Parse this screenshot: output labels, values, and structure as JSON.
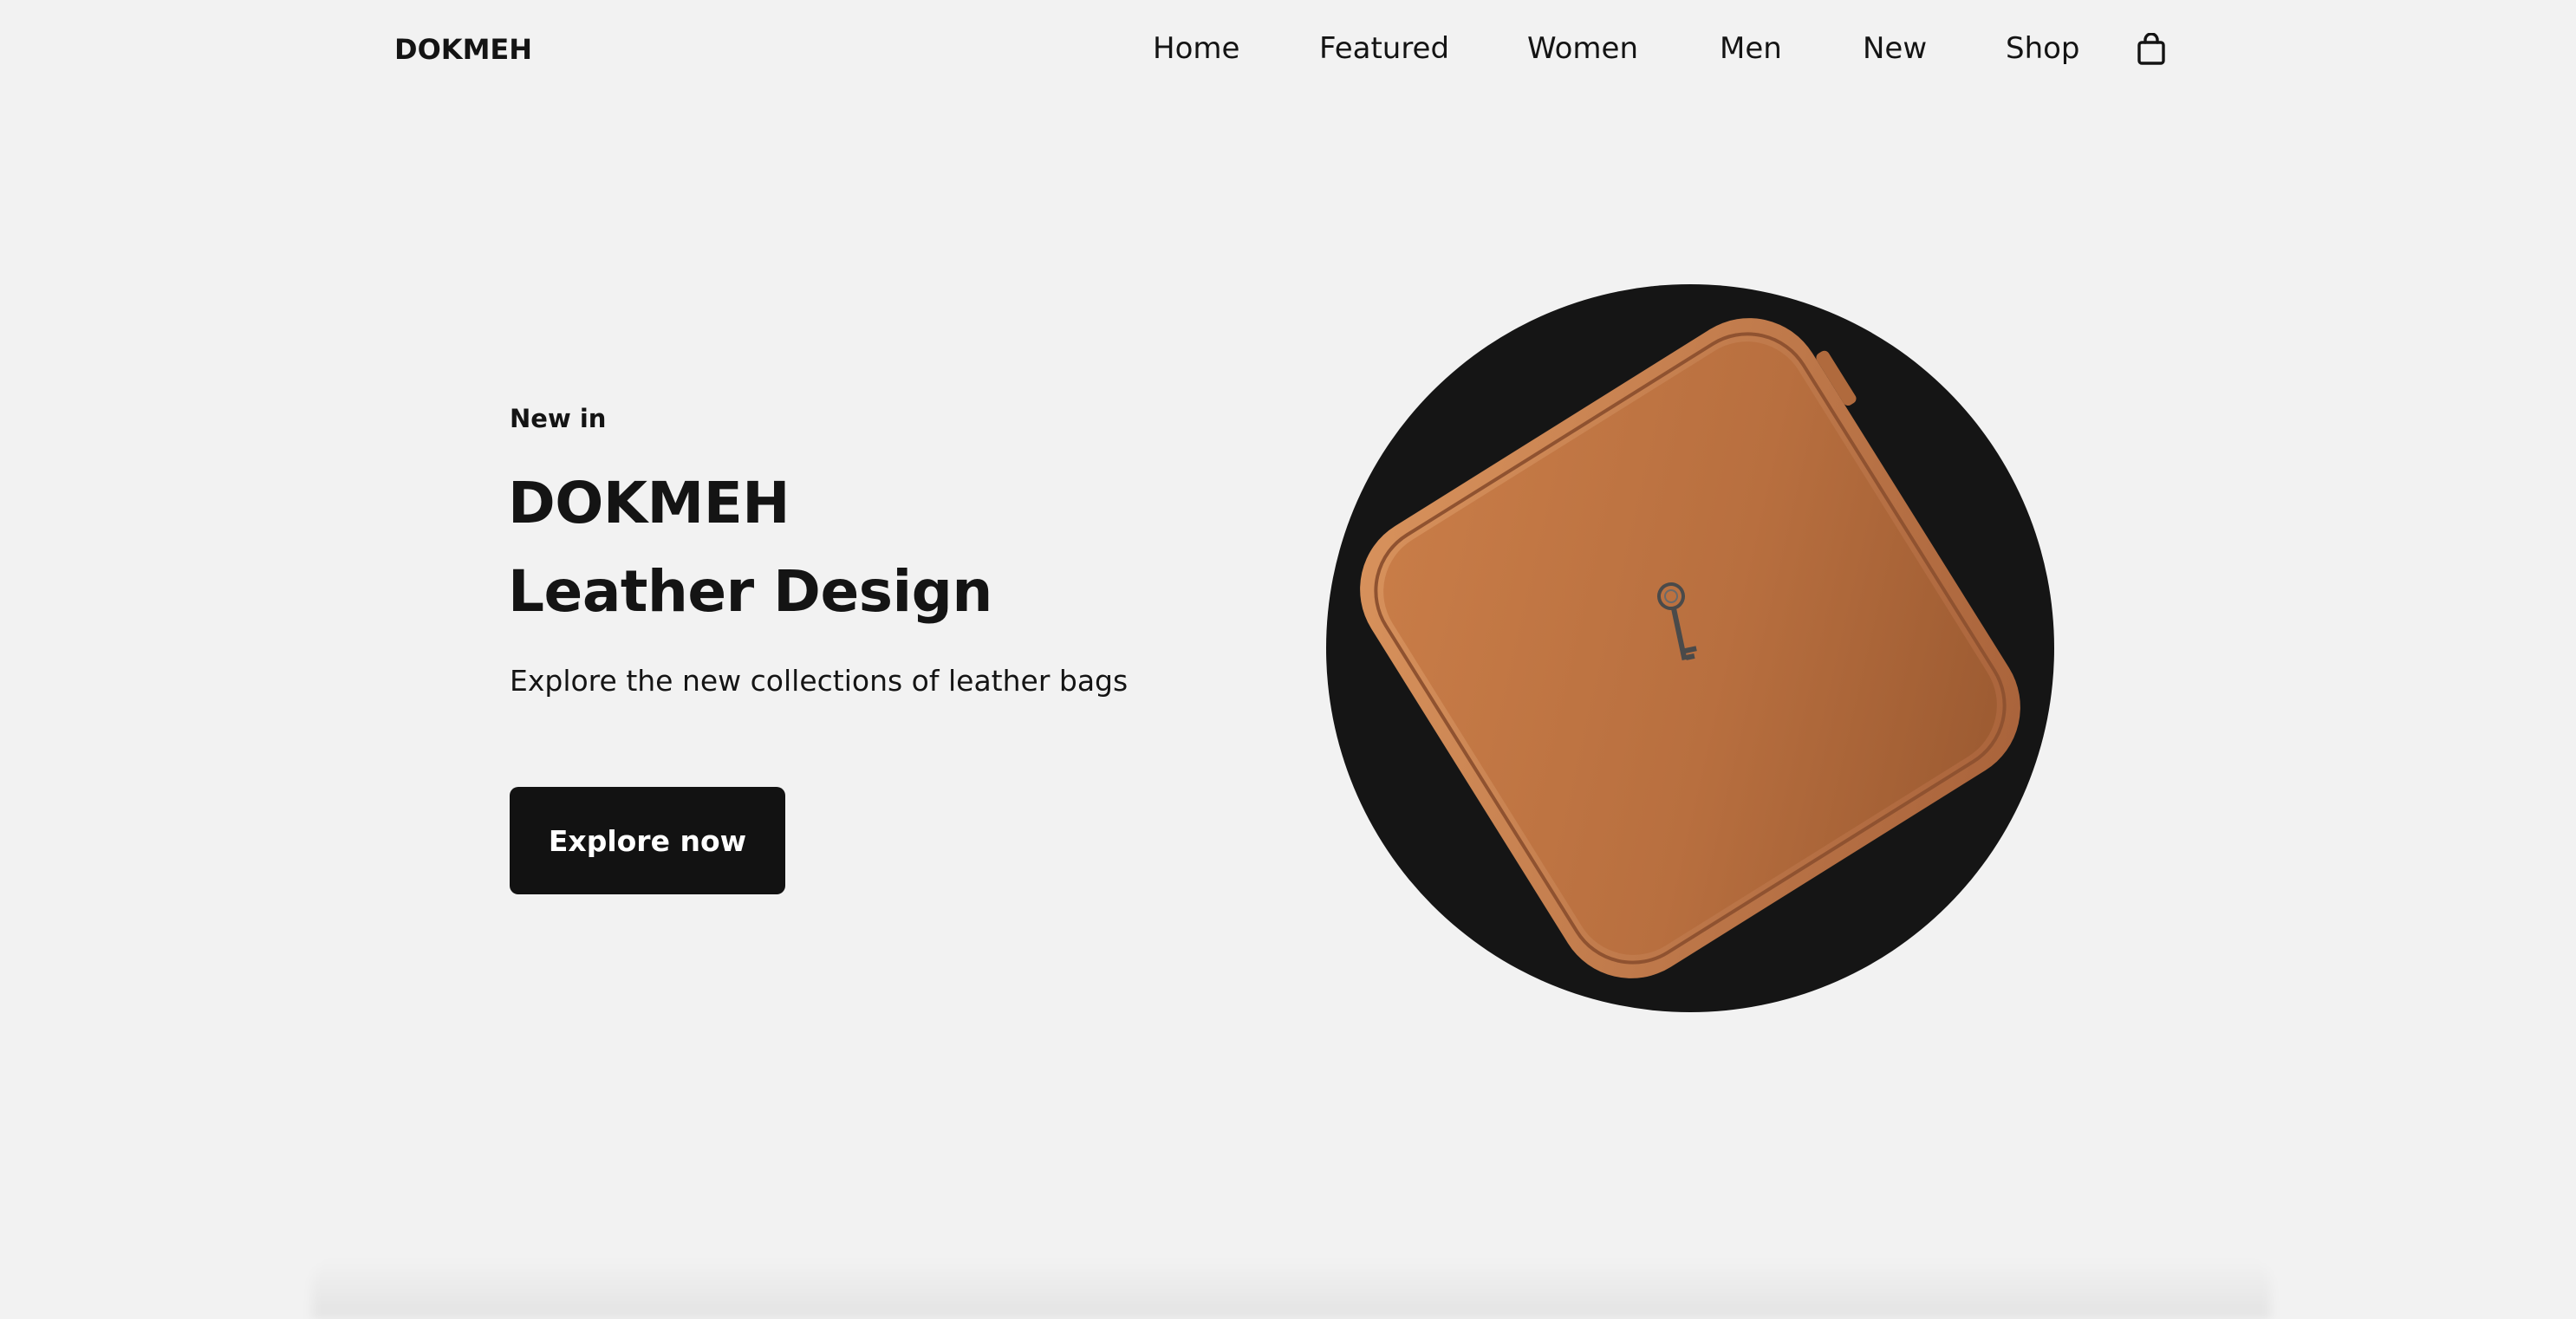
{
  "brand": {
    "name": "DOKMEH"
  },
  "nav": {
    "items": [
      "Home",
      "Featured",
      "Women",
      "Men",
      "New",
      "Shop"
    ],
    "cart_icon": "shopping-bag-icon"
  },
  "hero": {
    "kicker": "New in",
    "headline_line1": "DOKMEH",
    "headline_line2": "Leather Design",
    "subtitle": "Explore the new collections of leather bags",
    "cta_label": "Explore now",
    "image_subject": "brown leather square bag with key charm"
  },
  "colors": {
    "background": "#f2f2f2",
    "text": "#141414",
    "button": "#121212",
    "circle": "#151515",
    "leather": "#b86e3e"
  }
}
